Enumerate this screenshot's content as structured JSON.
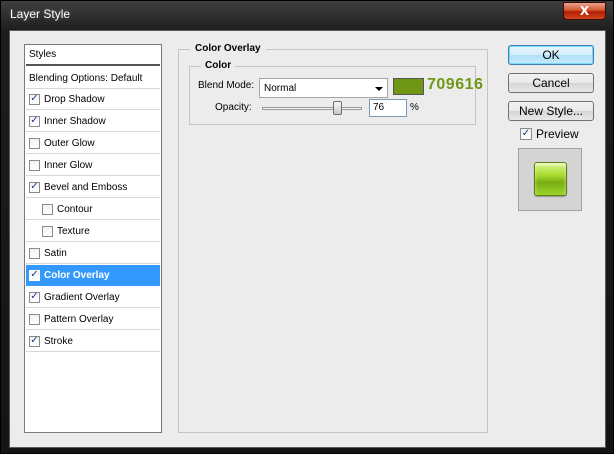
{
  "window": {
    "title": "Layer Style",
    "close_glyph": "X"
  },
  "styles": {
    "header_label": "Styles",
    "blending_label": "Blending Options: Default",
    "items": [
      {
        "label": "Drop Shadow",
        "checked": true,
        "indent": false,
        "selected": false
      },
      {
        "label": "Inner Shadow",
        "checked": true,
        "indent": false,
        "selected": false
      },
      {
        "label": "Outer Glow",
        "checked": false,
        "indent": false,
        "selected": false
      },
      {
        "label": "Inner Glow",
        "checked": false,
        "indent": false,
        "selected": false
      },
      {
        "label": "Bevel and Emboss",
        "checked": true,
        "indent": false,
        "selected": false
      },
      {
        "label": "Contour",
        "checked": false,
        "indent": true,
        "selected": false
      },
      {
        "label": "Texture",
        "checked": false,
        "indent": true,
        "selected": false
      },
      {
        "label": "Satin",
        "checked": false,
        "indent": false,
        "selected": false
      },
      {
        "label": "Color Overlay",
        "checked": true,
        "indent": false,
        "selected": true
      },
      {
        "label": "Gradient Overlay",
        "checked": true,
        "indent": false,
        "selected": false
      },
      {
        "label": "Pattern Overlay",
        "checked": false,
        "indent": false,
        "selected": false
      },
      {
        "label": "Stroke",
        "checked": true,
        "indent": false,
        "selected": false
      }
    ]
  },
  "panel": {
    "title": "Color Overlay",
    "section": "Color",
    "blend_mode_label": "Blend Mode:",
    "blend_mode_value": "Normal",
    "color_hex": "709616",
    "color_swatch": "#709616",
    "opacity_label": "Opacity:",
    "opacity_value": "76",
    "opacity_unit": "%",
    "opacity_level": 0.76
  },
  "buttons": {
    "ok": "OK",
    "cancel": "Cancel",
    "new_style": "New Style..."
  },
  "preview": {
    "label": "Preview",
    "checked": true,
    "check_glyph": "✓"
  },
  "colors": {
    "selection": "#3399ff",
    "hex_text": "#709616"
  }
}
